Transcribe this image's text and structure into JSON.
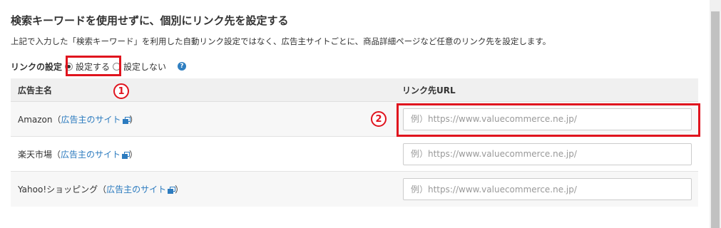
{
  "section": {
    "title": "検索キーワードを使用せずに、個別にリンク先を設定する",
    "description": "上記で入力した「検索キーワード」を利用した自動リンク設定ではなく、広告主サイトごとに、商品詳細ページなど任意のリンク先を設定します。"
  },
  "link_setting": {
    "label": "リンクの設定",
    "options": [
      {
        "label": "設定する",
        "selected": true
      },
      {
        "label": "設定しない",
        "selected": false
      }
    ],
    "help_icon": "?"
  },
  "annotations": {
    "badge1": "1",
    "badge2": "2",
    "color": "#e0141e"
  },
  "table": {
    "headers": {
      "name": "広告主名",
      "url": "リンク先URL"
    },
    "rows": [
      {
        "name": "Amazon",
        "open": "（",
        "link": "広告主のサイト",
        "close": "）",
        "placeholder": "例）https://www.valuecommerce.ne.jp/"
      },
      {
        "name": "楽天市場",
        "open": "（",
        "link": "広告主のサイト",
        "close": "）",
        "placeholder": "例）https://www.valuecommerce.ne.jp/"
      },
      {
        "name": "Yahoo!ショッピング",
        "open": "（",
        "link": "広告主のサイト",
        "close": "）",
        "placeholder": "例）https://www.valuecommerce.ne.jp/"
      }
    ]
  },
  "colors": {
    "link": "#2c7bbf",
    "header_bg": "#f0f0f0",
    "highlight": "#e0141e"
  },
  "icons": {
    "external_link": "external-link-icon",
    "help": "help-icon"
  }
}
